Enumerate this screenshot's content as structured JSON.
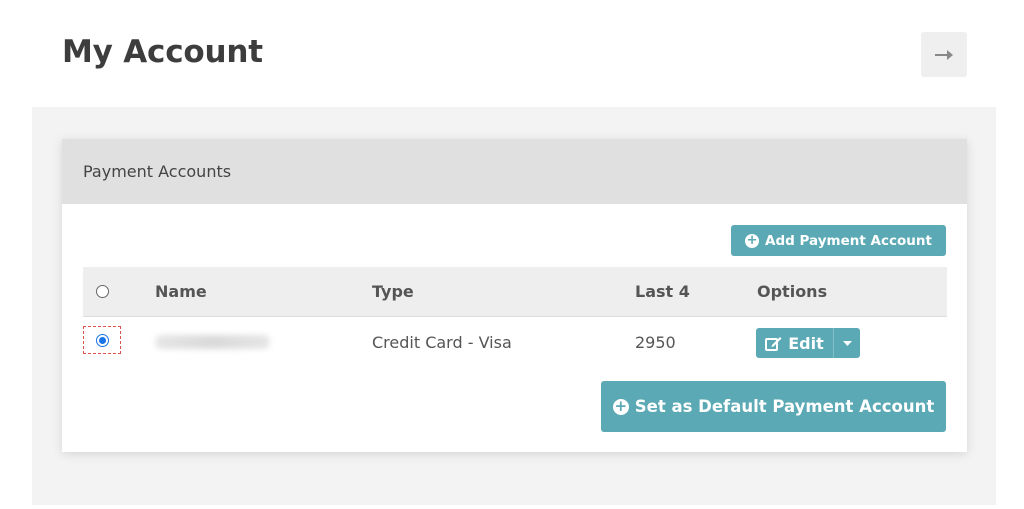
{
  "page": {
    "title": "My Account"
  },
  "header": {
    "logout_icon": "arrow-right-icon"
  },
  "card": {
    "title": "Payment Accounts",
    "add_button_label": "Add Payment Account",
    "set_default_button_label": "Set as Default Payment Account"
  },
  "table": {
    "columns": [
      "",
      "Name",
      "Type",
      "Last 4",
      "Options"
    ],
    "rows": [
      {
        "selected": true,
        "name": "",
        "type": "Credit Card - Visa",
        "last4": "2950",
        "edit_label": "Edit"
      }
    ]
  },
  "colors": {
    "accent": "#5aa9b4",
    "header_bg": "#e0e0e0",
    "radio_checked": "#1a73e8",
    "focus_outline": "#d9534f"
  }
}
